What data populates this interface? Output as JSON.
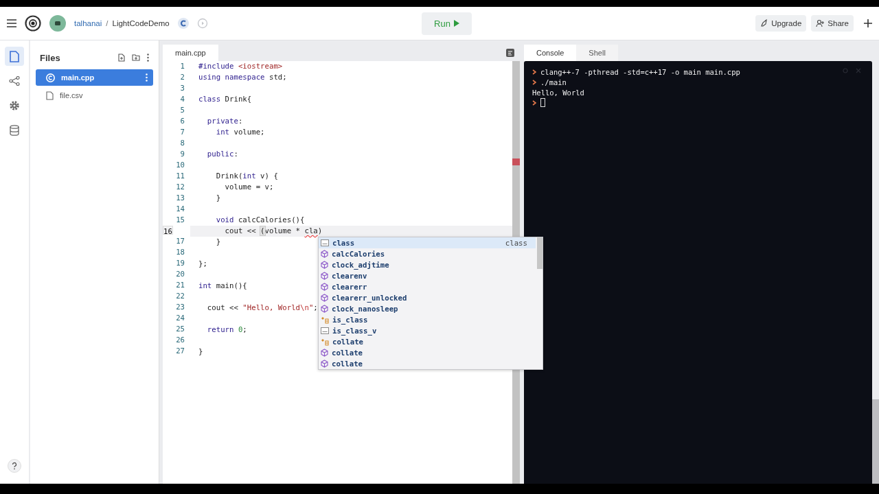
{
  "header": {
    "owner": "talhanai",
    "separator": "/",
    "project": "LightCodeDemo",
    "run_label": "Run",
    "buttons": [
      {
        "label": "Upgrade",
        "kind": "upgrade"
      },
      {
        "label": "Share",
        "kind": "share"
      }
    ]
  },
  "rail": [
    {
      "kind": "files",
      "selected": true
    },
    {
      "kind": "share",
      "selected": false
    },
    {
      "kind": "settings",
      "selected": false
    },
    {
      "kind": "database",
      "selected": false
    }
  ],
  "files": {
    "title": "Files",
    "items": [
      {
        "name": "main.cpp",
        "kind": "cpp",
        "selected": true
      },
      {
        "name": "file.csv",
        "kind": "file",
        "selected": false
      }
    ]
  },
  "editor": {
    "tab": "main.cpp",
    "lines": [
      {
        "n": "1",
        "current": false,
        "tokens": [
          {
            "t": "#include",
            "kind": "kw"
          },
          {
            "t": " <iostream>",
            "kind": "str"
          }
        ]
      },
      {
        "n": "2",
        "current": false,
        "tokens": [
          {
            "t": "using",
            "kind": "kw"
          },
          {
            "t": " namespace",
            "kind": "kw"
          },
          {
            "t": " std;",
            "kind": "plain"
          }
        ]
      },
      {
        "n": "3",
        "current": false
      },
      {
        "n": "4",
        "current": false,
        "tokens": [
          {
            "t": "class",
            "kind": "kw"
          },
          {
            "t": " Drink{",
            "kind": "plain"
          }
        ]
      },
      {
        "n": "5",
        "current": false
      },
      {
        "n": "6",
        "current": false,
        "tokens": [
          {
            "t": "  private",
            "kind": "kw"
          },
          {
            "t": ":",
            "kind": "plain"
          }
        ]
      },
      {
        "n": "7",
        "current": false,
        "tokens": [
          {
            "t": "    int",
            "kind": "kw"
          },
          {
            "t": " volume;",
            "kind": "plain"
          }
        ]
      },
      {
        "n": "8",
        "current": false
      },
      {
        "n": "9",
        "current": false,
        "tokens": [
          {
            "t": "  public",
            "kind": "kw"
          },
          {
            "t": ":",
            "kind": "plain"
          }
        ]
      },
      {
        "n": "10",
        "current": false
      },
      {
        "n": "11",
        "current": false,
        "tokens": [
          {
            "t": "    Drink(",
            "kind": "plain"
          },
          {
            "t": "int",
            "kind": "kw"
          },
          {
            "t": " v) {",
            "kind": "plain"
          }
        ]
      },
      {
        "n": "12",
        "current": false,
        "tokens": [
          {
            "t": "      volume = v;",
            "kind": "plain"
          }
        ]
      },
      {
        "n": "13",
        "current": false,
        "tokens": [
          {
            "t": "    }",
            "kind": "plain"
          }
        ]
      },
      {
        "n": "14",
        "current": false
      },
      {
        "n": "15",
        "current": false,
        "tokens": [
          {
            "t": "    void",
            "kind": "kw"
          },
          {
            "t": " calcCalories(){",
            "kind": "plain"
          }
        ]
      },
      {
        "n": "16",
        "current": true,
        "tokens": [
          {
            "t": "      cout << ",
            "kind": "plain"
          },
          {
            "t": "(",
            "kind": "match"
          },
          {
            "t": "volume * ",
            "kind": "plain"
          },
          {
            "t": "cla",
            "kind": "err"
          },
          {
            "t": ")",
            "kind": "plain"
          }
        ]
      },
      {
        "n": "17",
        "current": false,
        "tokens": [
          {
            "t": "    }",
            "kind": "plain"
          }
        ]
      },
      {
        "n": "18",
        "current": false
      },
      {
        "n": "19",
        "current": false,
        "tokens": [
          {
            "t": "};",
            "kind": "plain"
          }
        ]
      },
      {
        "n": "20",
        "current": false
      },
      {
        "n": "21",
        "current": false,
        "tokens": [
          {
            "t": "int",
            "kind": "kw"
          },
          {
            "t": " main(){",
            "kind": "plain"
          }
        ]
      },
      {
        "n": "22",
        "current": false
      },
      {
        "n": "23",
        "current": false,
        "tokens": [
          {
            "t": "  cout << ",
            "kind": "plain"
          },
          {
            "t": "\"Hello, World",
            "kind": "str"
          },
          {
            "t": "\\n",
            "kind": "esc"
          },
          {
            "t": "\"",
            "kind": "str"
          },
          {
            "t": ";",
            "kind": "plain"
          }
        ]
      },
      {
        "n": "24",
        "current": false
      },
      {
        "n": "25",
        "current": false,
        "tokens": [
          {
            "t": "  return",
            "kind": "kw"
          },
          {
            "t": " 0",
            "kind": "num"
          },
          {
            "t": ";",
            "kind": "plain"
          }
        ]
      },
      {
        "n": "26",
        "current": false
      },
      {
        "n": "27",
        "current": false,
        "tokens": [
          {
            "t": "}",
            "kind": "plain"
          }
        ]
      }
    ],
    "suggestions": [
      {
        "label": "class",
        "kind": "text",
        "selected": true,
        "detail": "class"
      },
      {
        "label": "calcCalories",
        "kind": "method",
        "selected": false
      },
      {
        "label": "clock_adjtime",
        "kind": "method",
        "selected": false
      },
      {
        "label": "clearenv",
        "kind": "method",
        "selected": false
      },
      {
        "label": "clearerr",
        "kind": "method",
        "selected": false
      },
      {
        "label": "clearerr_unlocked",
        "kind": "method",
        "selected": false
      },
      {
        "label": "clock_nanosleep",
        "kind": "method",
        "selected": false
      },
      {
        "label": "is_class",
        "kind": "struct",
        "selected": false
      },
      {
        "label": "is_class_v",
        "kind": "text",
        "selected": false
      },
      {
        "label": "collate",
        "kind": "struct",
        "selected": false
      },
      {
        "label": "collate",
        "kind": "method",
        "selected": false
      },
      {
        "label": "collate",
        "kind": "method",
        "selected": false
      }
    ]
  },
  "console": {
    "tabs": [
      {
        "label": "Console",
        "selected": true
      },
      {
        "label": "Shell",
        "selected": false
      }
    ],
    "lines": [
      {
        "kind": "command",
        "text": "clang++-7 -pthread -std=c++17 -o main main.cpp"
      },
      {
        "kind": "command",
        "text": "./main"
      },
      {
        "kind": "output",
        "text": "Hello, World"
      },
      {
        "kind": "cursor"
      }
    ]
  }
}
